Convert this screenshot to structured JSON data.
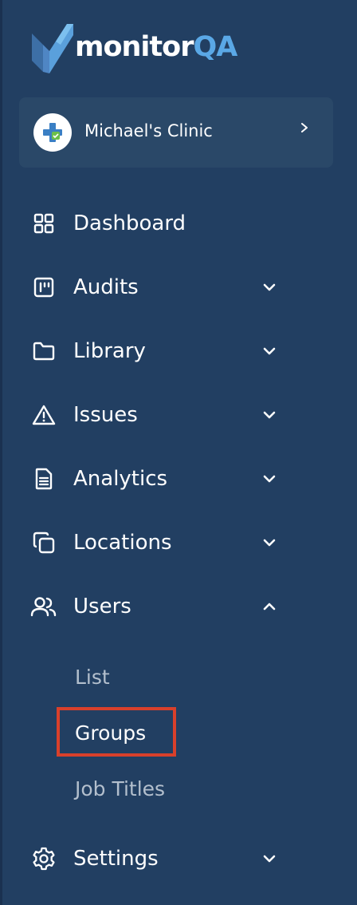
{
  "brand": {
    "name_part1": "monitor",
    "name_part2": "QA",
    "accent_color": "#5aa8e6",
    "logo_icon": "check-chevron-logo"
  },
  "clinic": {
    "name": "Michael's Clinic",
    "avatar_icon": "medical-cross-icon",
    "chevron_icon": "chevron-right-icon"
  },
  "nav": {
    "dashboard": {
      "label": "Dashboard",
      "icon": "grid-icon"
    },
    "audits": {
      "label": "Audits",
      "icon": "kanban-icon",
      "expanded": false
    },
    "library": {
      "label": "Library",
      "icon": "folder-icon",
      "expanded": false
    },
    "issues": {
      "label": "Issues",
      "icon": "warning-icon",
      "expanded": false
    },
    "analytics": {
      "label": "Analytics",
      "icon": "document-icon",
      "expanded": false
    },
    "locations": {
      "label": "Locations",
      "icon": "copy-icon",
      "expanded": false
    },
    "users": {
      "label": "Users",
      "icon": "users-icon",
      "expanded": true,
      "children": [
        "List",
        "Groups",
        "Job Titles"
      ],
      "active_child": "Groups"
    },
    "settings": {
      "label": "Settings",
      "icon": "gear-icon",
      "expanded": false
    }
  },
  "colors": {
    "sidebar_bg": "#223f62",
    "card_bg": "#2a4868",
    "highlight": "#d9402b",
    "dim_text": "#b3bfcd"
  }
}
